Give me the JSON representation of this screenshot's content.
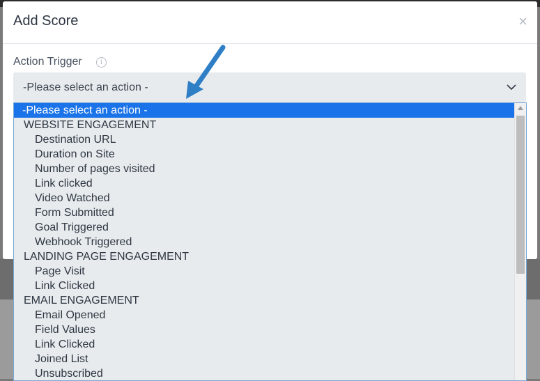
{
  "modal": {
    "title": "Add Score",
    "close_icon": "close-icon"
  },
  "field": {
    "label": "Action Trigger",
    "info_icon": "info-icon",
    "selected_value": "-Please select an action -"
  },
  "dropdown": {
    "options": [
      {
        "label": "-Please select an action -",
        "type": "selected"
      },
      {
        "label": "WEBSITE ENGAGEMENT",
        "type": "group"
      },
      {
        "label": "Destination URL",
        "type": "child"
      },
      {
        "label": "Duration on Site",
        "type": "child"
      },
      {
        "label": "Number of pages visited",
        "type": "child"
      },
      {
        "label": "Link clicked",
        "type": "child"
      },
      {
        "label": "Video Watched",
        "type": "child"
      },
      {
        "label": "Form Submitted",
        "type": "child"
      },
      {
        "label": "Goal Triggered",
        "type": "child"
      },
      {
        "label": "Webhook Triggered",
        "type": "child"
      },
      {
        "label": "LANDING PAGE ENGAGEMENT",
        "type": "group"
      },
      {
        "label": "Page Visit",
        "type": "child"
      },
      {
        "label": "Link Clicked",
        "type": "child"
      },
      {
        "label": "EMAIL ENGAGEMENT",
        "type": "group"
      },
      {
        "label": "Email Opened",
        "type": "child"
      },
      {
        "label": "Field Values",
        "type": "child"
      },
      {
        "label": "Link Clicked",
        "type": "child"
      },
      {
        "label": "Joined List",
        "type": "child"
      },
      {
        "label": "Unsubscribed",
        "type": "child"
      }
    ]
  },
  "colors": {
    "highlight": "#1a73e8",
    "arrow": "#2f7fc6"
  }
}
